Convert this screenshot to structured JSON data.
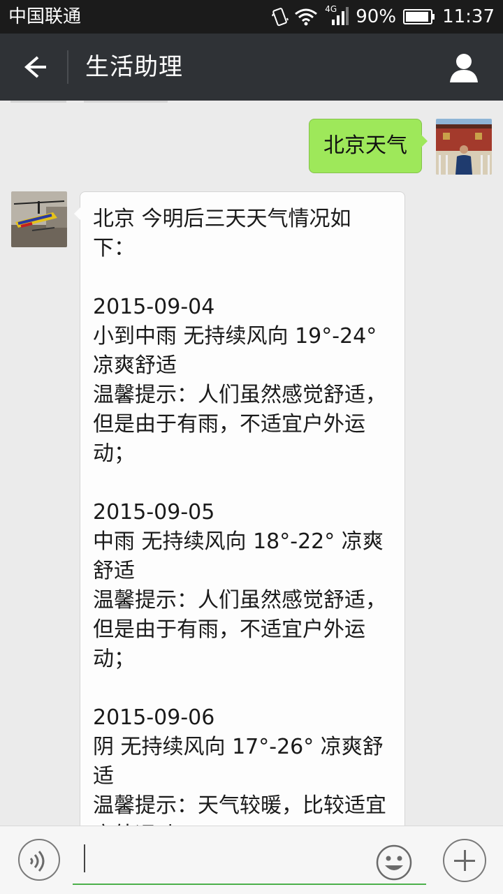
{
  "status_bar": {
    "carrier": "中国联通",
    "network": "4G",
    "battery": "90%",
    "time": "11:37"
  },
  "header": {
    "title": "生活助理",
    "back_icon": "back-arrow-icon",
    "profile_icon": "person-icon"
  },
  "messages": [
    {
      "from": "me",
      "text": "北京天气"
    },
    {
      "from": "bot",
      "text": "北京 今明后三天天气情况如下：\n\n2015-09-04\n小到中雨 无持续风向 19°-24° 凉爽舒适\n温馨提示：人们虽然感觉舒适，但是由于有雨，不适宜户外运动；\n\n2015-09-05\n中雨 无持续风向 18°-22° 凉爽舒适\n温馨提示：人们虽然感觉舒适，但是由于有雨，不适宜户外运动；\n\n2015-09-06\n阴 无持续风向 17°-26° 凉爽舒适\n温馨提示：天气较暖，比较适宜户外运动"
    }
  ],
  "input_bar": {
    "voice_icon": "voice-icon",
    "emoji_icon": "emoji-icon",
    "plus_icon": "plus-icon",
    "accent_color": "#4cb04a"
  }
}
